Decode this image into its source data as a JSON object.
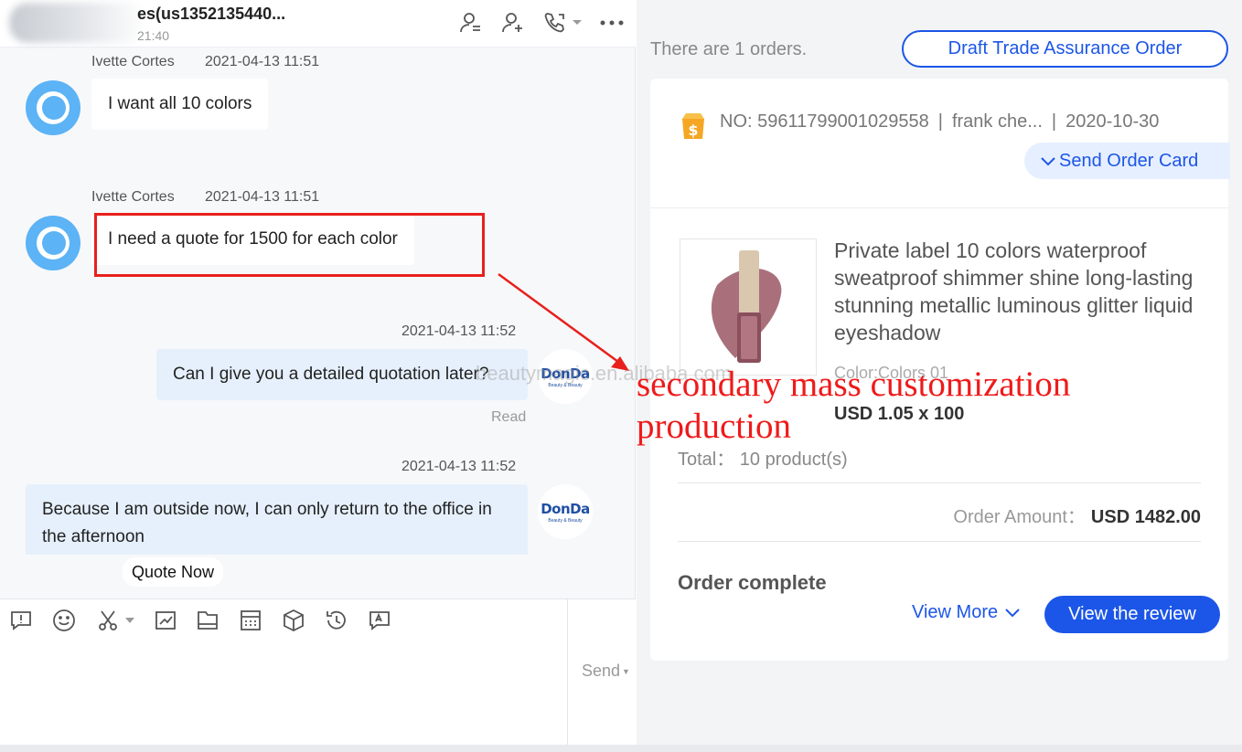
{
  "chat": {
    "header": {
      "title": "es(us1352135440...",
      "subtitle": "21:40",
      "icons": [
        "contact-profile-icon",
        "add-contact-icon",
        "phone-call-icon",
        "more-icon"
      ]
    },
    "messages": [
      {
        "sender": "Ivette Cortes",
        "time": "2021-04-13 11:51",
        "text": "I want all 10 colors",
        "direction": "in"
      },
      {
        "sender": "Ivette Cortes",
        "time": "2021-04-13 11:51",
        "text": "I need a quote for 1500 for each color",
        "direction": "in",
        "highlighted": true
      },
      {
        "time": "2021-04-13 11:52",
        "text": "Can I give you a detailed quotation later?",
        "direction": "out",
        "status": "Read"
      },
      {
        "time": "2021-04-13 11:52",
        "text": "Because I am outside now, I can only return to the office in the afternoon",
        "direction": "out"
      }
    ],
    "seller_avatar": {
      "name": "DonDa",
      "tagline": "Beauty & Beauty"
    },
    "quote_now": "Quote Now",
    "toolbar_icons": [
      "quick-reply-icon",
      "emoji-icon",
      "screenshot-scissors-icon",
      "chart-icon",
      "folder-icon",
      "calculator-icon",
      "product-box-icon",
      "history-icon",
      "translate-icon"
    ],
    "send_label": "Send"
  },
  "orders": {
    "count_text": "There are 1 orders.",
    "draft_button": "Draft Trade Assurance Order",
    "card": {
      "number": "NO: 59611799001029558",
      "buyer": "frank che...",
      "date": "2020-10-30",
      "send_card_button": "Send Order Card",
      "product_title": "Private label 10 colors waterproof sweatproof shimmer shine long-lasting stunning metallic luminous glitter liquid eyeshadow",
      "product_color": "Color:Colors 01",
      "product_price": "USD 1.05 x 100",
      "total": "Total： 10 product(s)",
      "amount_label": "Order Amount：",
      "amount_value": "USD 1482.00",
      "status": "Order complete",
      "view_more": "View More",
      "review_button": "View the review"
    }
  },
  "overlay": {
    "watermark": "beautymagic.en.alibaba.com",
    "annotation_line1": "secondary mass customization",
    "annotation_line2": "production",
    "accent_red": "#e8201c",
    "accent_blue": "#1c56e8"
  }
}
